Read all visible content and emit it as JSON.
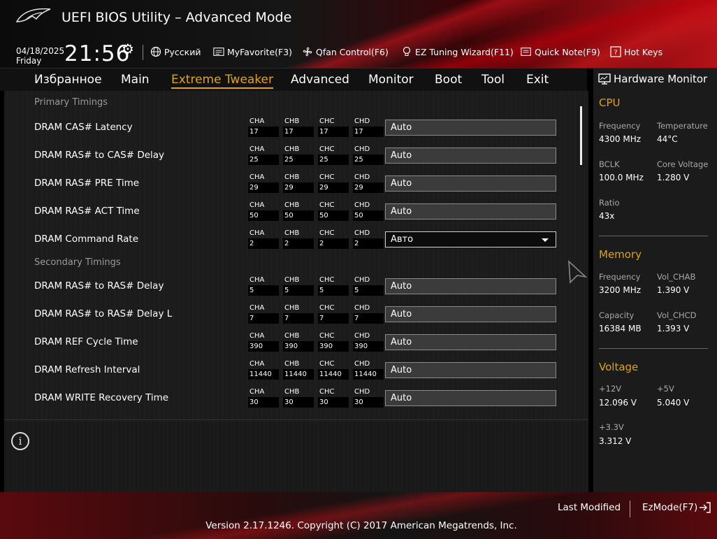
{
  "header": {
    "title": "UEFI BIOS Utility – Advanced Mode",
    "date": "04/18/2025",
    "day": "Friday",
    "time": "21:56",
    "toolbar": {
      "language": "Русский",
      "favorite": "MyFavorite(F3)",
      "qfan": "Qfan Control(F6)",
      "ez_wizard": "EZ Tuning Wizard(F11)",
      "quick_note": "Quick Note(F9)",
      "hot_keys": "Hot Keys"
    }
  },
  "tabs": [
    "Избранное",
    "Main",
    "Extreme Tweaker",
    "Advanced",
    "Monitor",
    "Boot",
    "Tool",
    "Exit"
  ],
  "active_tab": "Extreme Tweaker",
  "channels": [
    "CHA",
    "CHB",
    "CHC",
    "CHD"
  ],
  "sections": {
    "primary": "Primary Timings",
    "secondary": "Secondary Timings"
  },
  "rows": [
    {
      "label": "DRAM CAS# Latency",
      "values": [
        "17",
        "17",
        "17",
        "17"
      ],
      "setting": "Auto"
    },
    {
      "label": "DRAM RAS# to CAS# Delay",
      "values": [
        "25",
        "25",
        "25",
        "25"
      ],
      "setting": "Auto"
    },
    {
      "label": "DRAM RAS# PRE Time",
      "values": [
        "29",
        "29",
        "29",
        "29"
      ],
      "setting": "Auto"
    },
    {
      "label": "DRAM RAS# ACT Time",
      "values": [
        "50",
        "50",
        "50",
        "50"
      ],
      "setting": "Auto"
    },
    {
      "label": "DRAM Command Rate",
      "values": [
        "2",
        "2",
        "2",
        "2"
      ],
      "setting": "Авто"
    },
    {
      "label": "DRAM RAS# to RAS# Delay",
      "values": [
        "5",
        "5",
        "5",
        "5"
      ],
      "setting": "Auto"
    },
    {
      "label": "DRAM RAS# to RAS# Delay L",
      "values": [
        "7",
        "7",
        "7",
        "7"
      ],
      "setting": "Auto"
    },
    {
      "label": "DRAM REF Cycle Time",
      "values": [
        "390",
        "390",
        "390",
        "390"
      ],
      "setting": "Auto"
    },
    {
      "label": "DRAM Refresh Interval",
      "values": [
        "11440",
        "11440",
        "11440",
        "11440"
      ],
      "setting": "Auto"
    },
    {
      "label": "DRAM WRITE Recovery Time",
      "values": [
        "30",
        "30",
        "30",
        "30"
      ],
      "setting": "Auto"
    }
  ],
  "hardware_monitor": {
    "title": "Hardware Monitor",
    "cpu": {
      "heading": "CPU",
      "frequency_label": "Frequency",
      "frequency": "4300 MHz",
      "temperature_label": "Temperature",
      "temperature": "44°C",
      "bclk_label": "BCLK",
      "bclk": "100.0 MHz",
      "core_voltage_label": "Core Voltage",
      "core_voltage": "1.280 V",
      "ratio_label": "Ratio",
      "ratio": "43x"
    },
    "memory": {
      "heading": "Memory",
      "frequency_label": "Frequency",
      "frequency": "3200 MHz",
      "vol_chab_label": "Vol_CHAB",
      "vol_chab": "1.390 V",
      "capacity_label": "Capacity",
      "capacity": "16384 MB",
      "vol_chcd_label": "Vol_CHCD",
      "vol_chcd": "1.393 V"
    },
    "voltage": {
      "heading": "Voltage",
      "v12_label": "+12V",
      "v12": "12.096 V",
      "v5_label": "+5V",
      "v5": "5.040 V",
      "v33_label": "+3.3V",
      "v33": "3.312 V"
    }
  },
  "footer": {
    "last_modified": "Last Modified",
    "ezmode": "EzMode(F7)",
    "version": "Version 2.17.1246. Copyright (C) 2017 American Megatrends, Inc."
  }
}
